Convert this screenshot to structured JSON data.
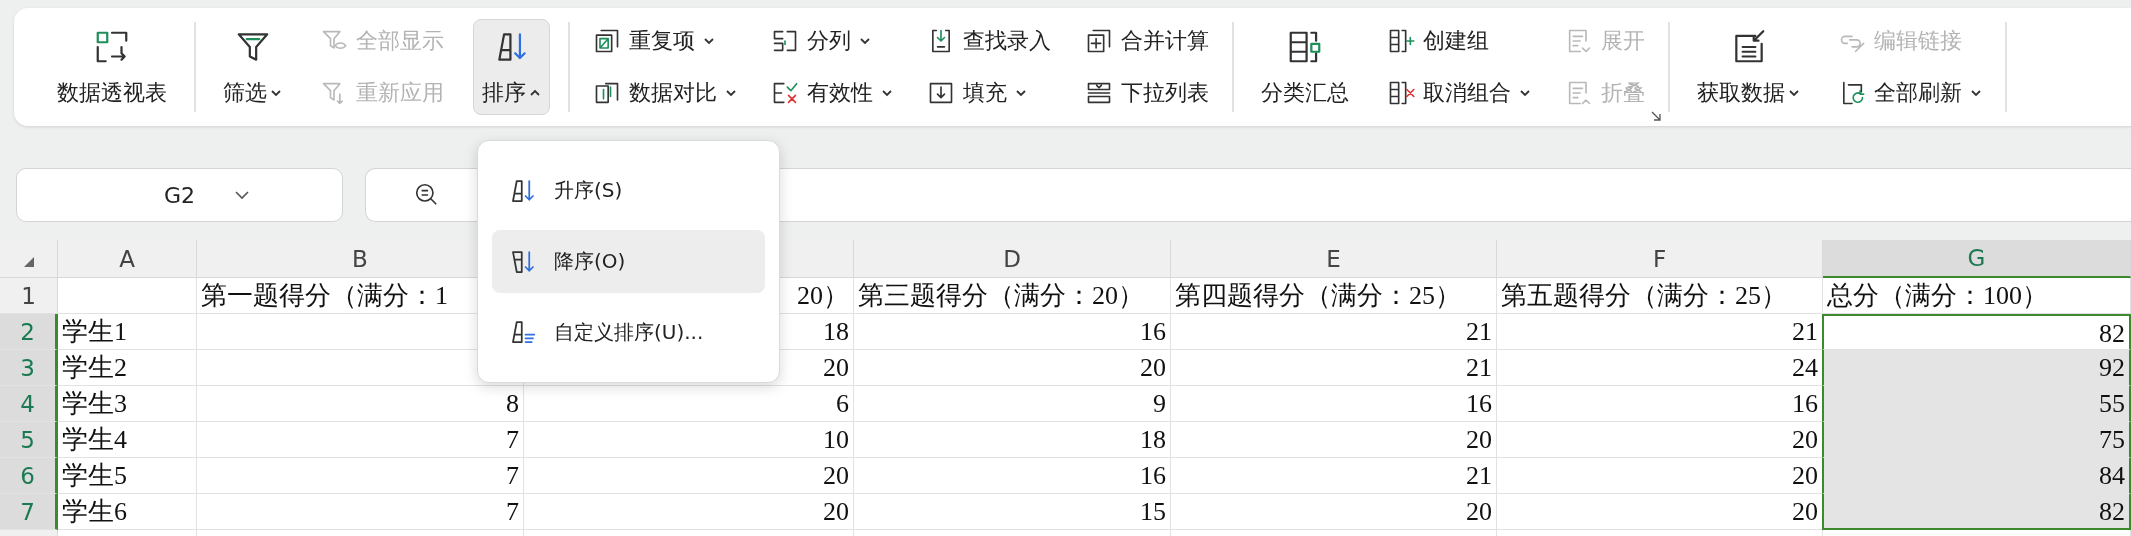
{
  "ribbon": {
    "groups": [
      {
        "columns": [
          {
            "kind": "large",
            "label": "数据透视表",
            "dropdown": false,
            "disabled": false,
            "expanded": false
          }
        ]
      },
      {
        "columns": [
          {
            "kind": "large",
            "label": "筛选",
            "dropdown": true,
            "disabled": false,
            "expanded": false
          },
          {
            "kind": "stack",
            "buttons": [
              {
                "label": "全部显示",
                "dropdown": false,
                "disabled": true
              },
              {
                "label": "重新应用",
                "dropdown": false,
                "disabled": true
              }
            ]
          },
          {
            "kind": "large",
            "label": "排序",
            "dropdown": true,
            "disabled": false,
            "expanded": true
          }
        ]
      },
      {
        "columns": [
          {
            "kind": "stack",
            "buttons": [
              {
                "label": "重复项",
                "dropdown": true,
                "disabled": false
              },
              {
                "label": "数据对比",
                "dropdown": true,
                "disabled": false
              }
            ]
          },
          {
            "kind": "stack",
            "buttons": [
              {
                "label": "分列",
                "dropdown": true,
                "disabled": false
              },
              {
                "label": "有效性",
                "dropdown": true,
                "disabled": false
              }
            ]
          },
          {
            "kind": "stack",
            "buttons": [
              {
                "label": "查找录入",
                "dropdown": false,
                "disabled": false
              },
              {
                "label": "填充",
                "dropdown": true,
                "disabled": false
              }
            ]
          },
          {
            "kind": "stack",
            "buttons": [
              {
                "label": "合并计算",
                "dropdown": false,
                "disabled": false
              },
              {
                "label": "下拉列表",
                "dropdown": false,
                "disabled": false
              }
            ]
          }
        ]
      },
      {
        "launcher": true,
        "columns": [
          {
            "kind": "large",
            "label": "分类汇总",
            "dropdown": false,
            "disabled": false,
            "expanded": false
          },
          {
            "kind": "stack",
            "buttons": [
              {
                "label": "创建组",
                "dropdown": false,
                "disabled": false
              },
              {
                "label": "取消组合",
                "dropdown": true,
                "disabled": false
              }
            ]
          },
          {
            "kind": "stack",
            "buttons": [
              {
                "label": "展开",
                "dropdown": false,
                "disabled": true
              },
              {
                "label": "折叠",
                "dropdown": false,
                "disabled": true
              }
            ]
          }
        ]
      },
      {
        "columns": [
          {
            "kind": "large",
            "label": "获取数据",
            "dropdown": true,
            "disabled": false,
            "expanded": false
          },
          {
            "kind": "stack",
            "buttons": [
              {
                "label": "编辑链接",
                "dropdown": false,
                "disabled": true
              },
              {
                "label": "全部刷新",
                "dropdown": true,
                "disabled": false
              }
            ]
          }
        ]
      }
    ]
  },
  "name_box": {
    "value": "G2"
  },
  "sort_menu": {
    "items": [
      {
        "label": "升序(S)",
        "highlighted": false
      },
      {
        "label": "降序(O)",
        "highlighted": true
      },
      {
        "label": "自定义排序(U)...",
        "highlighted": false
      }
    ]
  },
  "sheet": {
    "columns": [
      {
        "label": "A",
        "selected": false
      },
      {
        "label": "B",
        "selected": false
      },
      {
        "selected": false
      },
      {
        "label": "D",
        "selected": false
      },
      {
        "label": "E",
        "selected": false
      },
      {
        "label": "F",
        "selected": false
      },
      {
        "label": "G",
        "selected": true
      }
    ],
    "rows": [
      {
        "number": "1",
        "selected": false,
        "cells": [
          null,
          "第一题得分（满分：1",
          "20）",
          "第三题得分（满分：20）",
          "第四题得分（满分：25）",
          "第五题得分（满分：25）",
          "总分（满分：100）"
        ]
      },
      {
        "number": "2",
        "selected": true,
        "cells": [
          "学生1",
          null,
          "18",
          "16",
          "21",
          "21",
          "82"
        ]
      },
      {
        "number": "3",
        "selected": true,
        "cells": [
          "学生2",
          null,
          "20",
          "20",
          "21",
          "24",
          "92"
        ]
      },
      {
        "number": "4",
        "selected": true,
        "cells": [
          "学生3",
          "8",
          "6",
          "9",
          "16",
          "16",
          "55"
        ]
      },
      {
        "number": "5",
        "selected": true,
        "cells": [
          "学生4",
          "7",
          "10",
          "18",
          "20",
          "20",
          "75"
        ]
      },
      {
        "number": "6",
        "selected": true,
        "cells": [
          "学生5",
          "7",
          "20",
          "16",
          "21",
          "20",
          "84"
        ]
      },
      {
        "number": "7",
        "selected": true,
        "cells": [
          "学生6",
          "7",
          "20",
          "15",
          "20",
          "20",
          "82"
        ]
      }
    ]
  }
}
